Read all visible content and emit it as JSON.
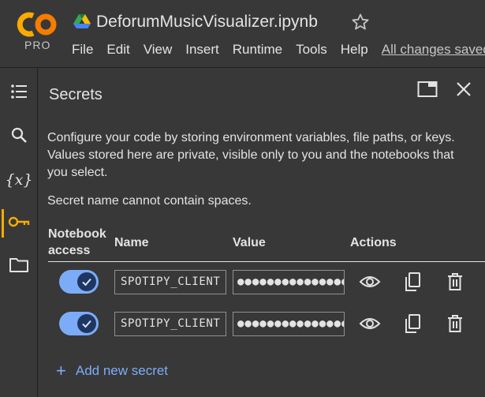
{
  "app": {
    "logo_text": "CO",
    "tier": "PRO",
    "doc_title": "DeforumMusicVisualizer.ipynb",
    "icons": {
      "logo": "colab-logo",
      "drive": "drive-icon",
      "star": "star-icon"
    }
  },
  "menu": {
    "items": [
      {
        "label": "File"
      },
      {
        "label": "Edit"
      },
      {
        "label": "View"
      },
      {
        "label": "Insert"
      },
      {
        "label": "Runtime"
      },
      {
        "label": "Tools"
      },
      {
        "label": "Help"
      }
    ],
    "status": "All changes saved"
  },
  "rail": {
    "items": [
      {
        "icon": "table-of-contents-icon"
      },
      {
        "icon": "search-icon"
      },
      {
        "icon": "variables-icon",
        "label": "{x}"
      },
      {
        "icon": "key-icon",
        "active": true
      },
      {
        "icon": "folder-icon"
      }
    ]
  },
  "panel": {
    "title": "Secrets",
    "description": "Configure your code by storing environment variables, file paths, or keys. Values stored here are private, visible only to you and the notebooks that you select.",
    "note": "Secret name cannot contain spaces.",
    "columns": {
      "access": "Notebook access",
      "name": "Name",
      "value": "Value",
      "actions": "Actions"
    },
    "rows": [
      {
        "access": true,
        "name": "SPOTIPY_CLIENT",
        "value": "●●●●●●●●●●●●●●●●"
      },
      {
        "access": true,
        "name": "SPOTIPY_CLIENT",
        "value": "●●●●●●●●●●●●●●●●"
      }
    ],
    "add_label": "Add new secret"
  },
  "colors": {
    "background": "#383838",
    "accent_blue": "#7cacf8",
    "active_orange": "#f9ab00",
    "text": "#e3e3e3"
  }
}
